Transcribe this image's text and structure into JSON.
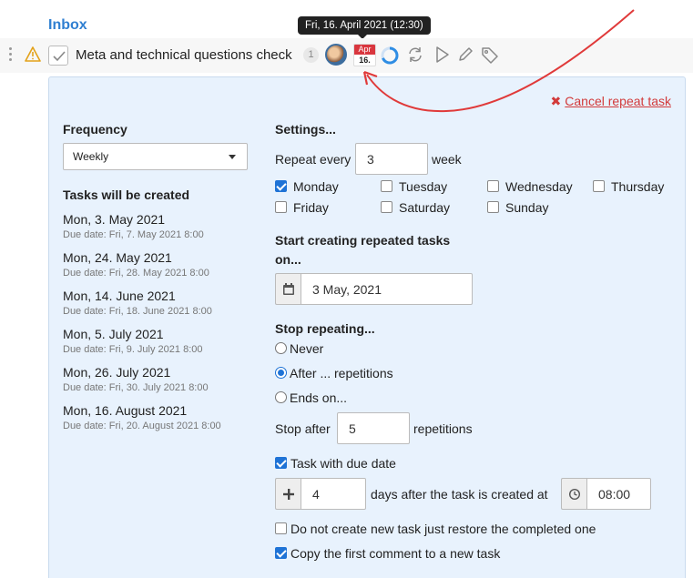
{
  "header": {
    "title": "Inbox"
  },
  "tooltip": {
    "text": "Fri, 16. April 2021 (12:30)"
  },
  "task": {
    "title": "Meta and technical questions check",
    "count": "1",
    "calendar_month": "Apr",
    "calendar_day": "16."
  },
  "panel": {
    "cancel_label": "Cancel repeat task",
    "frequency": {
      "heading": "Frequency",
      "selected": "Weekly"
    },
    "created": {
      "heading": "Tasks will be created",
      "items": [
        {
          "date": "Mon, 3. May 2021",
          "due": "Due date: Fri, 7. May 2021 8:00"
        },
        {
          "date": "Mon, 24. May 2021",
          "due": "Due date: Fri, 28. May 2021 8:00"
        },
        {
          "date": "Mon, 14. June 2021",
          "due": "Due date: Fri, 18. June 2021 8:00"
        },
        {
          "date": "Mon, 5. July 2021",
          "due": "Due date: Fri, 9. July 2021 8:00"
        },
        {
          "date": "Mon, 26. July 2021",
          "due": "Due date: Fri, 30. July 2021 8:00"
        },
        {
          "date": "Mon, 16. August 2021",
          "due": "Due date: Fri, 20. August 2021 8:00"
        }
      ]
    },
    "settings": {
      "heading": "Settings...",
      "repeat_every_label": "Repeat every",
      "repeat_every_value": "3",
      "repeat_unit": "week",
      "days": [
        {
          "label": "Monday",
          "checked": true
        },
        {
          "label": "Tuesday",
          "checked": false
        },
        {
          "label": "Wednesday",
          "checked": false
        },
        {
          "label": "Thursday",
          "checked": false
        },
        {
          "label": "Friday",
          "checked": false
        },
        {
          "label": "Saturday",
          "checked": false
        },
        {
          "label": "Sunday",
          "checked": false
        }
      ],
      "start_heading_1": "Start creating repeated tasks",
      "start_heading_2": "on...",
      "start_date": "3 May, 2021",
      "stop_heading": "Stop repeating...",
      "stop_options": [
        {
          "label": "Never",
          "selected": false
        },
        {
          "label": "After ... repetitions",
          "selected": true
        },
        {
          "label": "Ends on...",
          "selected": false
        }
      ],
      "stop_after_label": "Stop after",
      "stop_after_value": "5",
      "stop_after_unit": "repetitions",
      "due_date_label": "Task with due date",
      "due_date_checked": true,
      "due_days_value": "4",
      "due_days_label": "days after the task is created at",
      "due_time": "08:00",
      "restore_label": "Do not create new task just restore the completed one",
      "restore_checked": false,
      "copy_comment_label": "Copy the first comment to a new task",
      "copy_comment_checked": true
    }
  },
  "colors": {
    "accent": "#1f73d6",
    "link_red": "#d23a3a",
    "panel_bg": "#e8f2fd",
    "title_blue": "#2f7fd1",
    "annotation_arrow": "#e03a3a"
  }
}
